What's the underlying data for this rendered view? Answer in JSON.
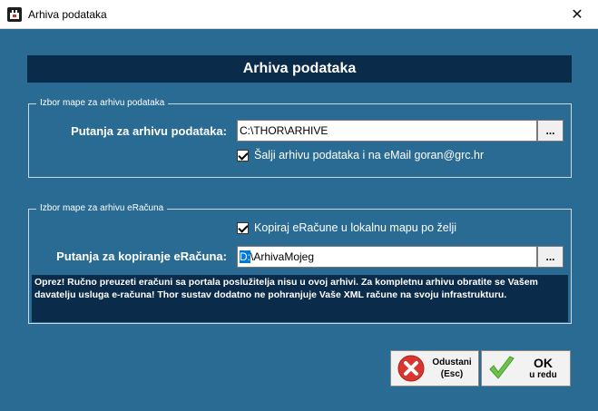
{
  "window": {
    "title": "Arhiva podataka",
    "close_glyph": "✕",
    "app_icon": "app-logo-icon"
  },
  "header": {
    "title": "Arhiva podataka"
  },
  "group_data": {
    "legend": "Izbor mape za arhivu podataka",
    "path_label": "Putanja za arhivu podataka:",
    "path_value": "C:\\THOR\\ARHIVE",
    "browse_label": "...",
    "email_checkbox_label": "Šalji arhivu podataka i na eMail goran@grc.hr",
    "email_checked": true
  },
  "group_einvoice": {
    "legend": "Izbor mape za arhivu eRačuna",
    "copy_checkbox_label": "Kopiraj eRačune u lokalnu mapu po želji",
    "copy_checked": true,
    "path_label": "Putanja za kopiranje eRačuna:",
    "path_value_selected": "D:",
    "path_value_rest": "\\ArhivaMojeg",
    "browse_label": "...",
    "warning": "Oprez! Ručno preuzeti eračuni sa portala poslužitelja nisu u ovoj arhivi. Za kompletnu arhivu obratite se Vašem davatelju usluga e-računa! Thor sustav dodatno ne pohranjuje Vaše XML račune na svoju infrastrukturu."
  },
  "buttons": {
    "cancel_line1": "Odustani",
    "cancel_line2": "(Esc)",
    "cancel_icon": "cancel-x-icon",
    "ok_main": "OK",
    "ok_sub": "u redu",
    "ok_icon": "checkmark-icon"
  },
  "colors": {
    "background": "#2a6b93",
    "header_bar": "#0a2b49",
    "warning_bg": "#0a2b49",
    "cancel_red": "#d9362f",
    "ok_green": "#6cc24a"
  }
}
